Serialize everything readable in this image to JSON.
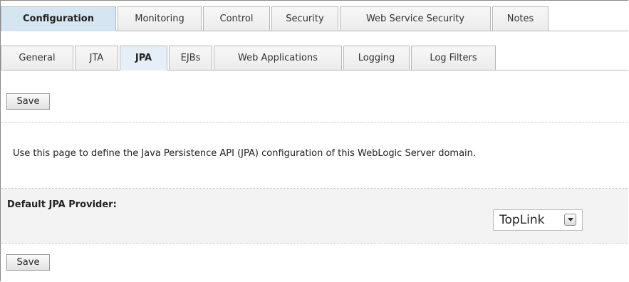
{
  "tabs_primary": [
    {
      "label": "Configuration",
      "active": true
    },
    {
      "label": "Monitoring",
      "active": false
    },
    {
      "label": "Control",
      "active": false
    },
    {
      "label": "Security",
      "active": false
    },
    {
      "label": "Web Service Security",
      "active": false
    },
    {
      "label": "Notes",
      "active": false
    }
  ],
  "tabs_secondary": [
    {
      "label": "General",
      "active": false
    },
    {
      "label": "JTA",
      "active": false
    },
    {
      "label": "JPA",
      "active": true
    },
    {
      "label": "EJBs",
      "active": false
    },
    {
      "label": "Web Applications",
      "active": false
    },
    {
      "label": "Logging",
      "active": false
    },
    {
      "label": "Log Filters",
      "active": false
    }
  ],
  "buttons": {
    "save_top": "Save",
    "save_bottom": "Save"
  },
  "description": "Use this page to define the Java Persistence API (JPA) configuration of this WebLogic Server domain.",
  "default_jpa_provider": {
    "label": "Default JPA Provider:",
    "value": "TopLink"
  },
  "colors": {
    "active_tab": "#d6e5f2",
    "inactive_tab": "#f0f0f0",
    "row_background": "#f3f3f3"
  }
}
